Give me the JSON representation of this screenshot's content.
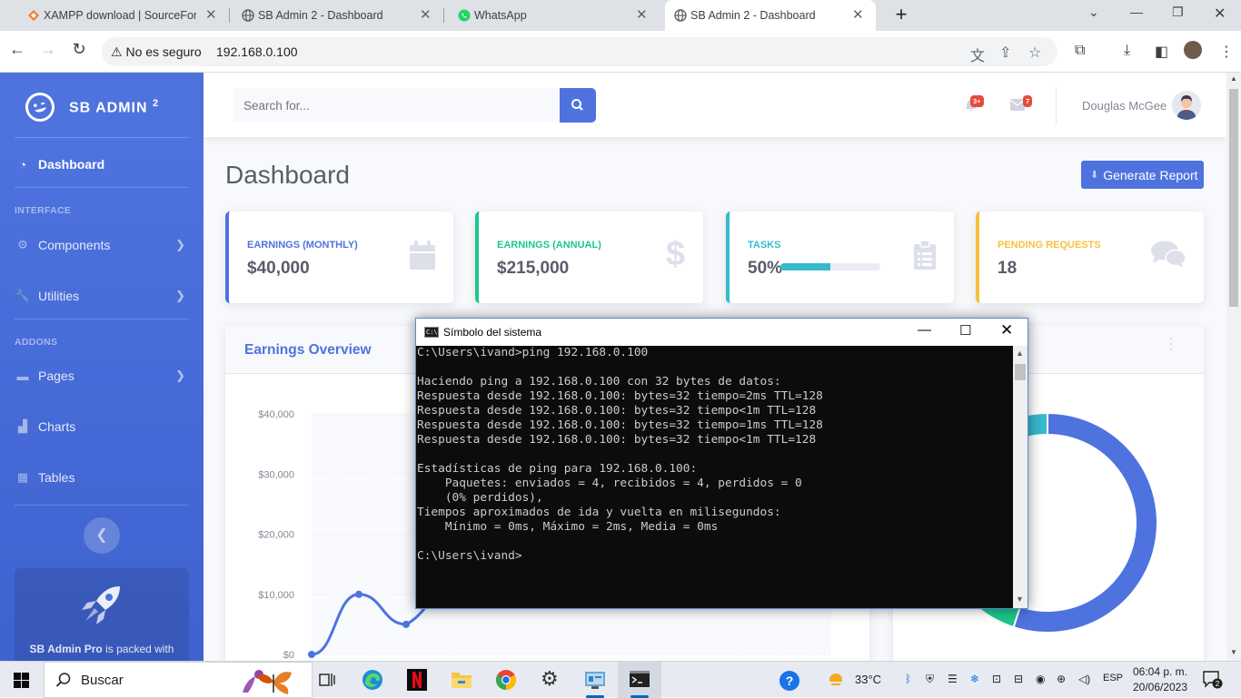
{
  "browser": {
    "tabs": [
      {
        "title": "XAMPP download | SourceForge",
        "icon": "xampp-icon"
      },
      {
        "title": "SB Admin 2 - Dashboard",
        "icon": "globe-icon"
      },
      {
        "title": "WhatsApp",
        "icon": "whatsapp-icon"
      },
      {
        "title": "SB Admin 2 - Dashboard",
        "icon": "globe-icon",
        "active": true
      }
    ],
    "new_tab": "+",
    "security_label": "No es seguro",
    "url": "192.168.0.100"
  },
  "sidebar": {
    "brand": "SB ADMIN",
    "brand_sup": "2",
    "dashboard": "Dashboard",
    "interface_heading": "INTERFACE",
    "components": "Components",
    "utilities": "Utilities",
    "addons_heading": "ADDONS",
    "pages": "Pages",
    "charts": "Charts",
    "tables": "Tables",
    "promo_strong": "SB Admin Pro",
    "promo_text": " is packed with premium features"
  },
  "topbar": {
    "search_placeholder": "Search for...",
    "alerts_badge": "3+",
    "messages_badge": "7",
    "username": "Douglas McGee"
  },
  "main": {
    "title": "Dashboard",
    "report_button": "Generate Report",
    "cards": [
      {
        "label": "EARNINGS (MONTHLY)",
        "value": "$40,000",
        "color": "#4e73df",
        "icon": "calendar-icon"
      },
      {
        "label": "EARNINGS (ANNUAL)",
        "value": "$215,000",
        "color": "#1cc88a",
        "icon": "dollar-icon"
      },
      {
        "label": "TASKS",
        "value": "50%",
        "color": "#36b9cc",
        "icon": "clipboard-icon",
        "progress": 0.5
      },
      {
        "label": "PENDING REQUESTS",
        "value": "18",
        "color": "#f6c23e",
        "icon": "comments-icon"
      }
    ],
    "earnings_title": "Earnings Overview"
  },
  "chart_data": [
    {
      "type": "line",
      "title": "Earnings Overview",
      "y_ticks": [
        "$0",
        "$10,000",
        "$20,000",
        "$30,000",
        "$40,000"
      ],
      "ylim": [
        0,
        40000
      ],
      "series": [
        {
          "values": [
            0,
            10000,
            5000
          ]
        }
      ],
      "grid": true,
      "color": "#4e73df"
    },
    {
      "type": "pie",
      "variant": "doughnut",
      "series": [
        {
          "values": [
            55,
            30,
            15
          ]
        }
      ],
      "colors": [
        "#4e73df",
        "#1cc88a",
        "#36b9cc"
      ]
    }
  ],
  "cmd": {
    "title": "Símbolo del sistema",
    "lines": [
      "C:\\Users\\ivand>ping 192.168.0.100",
      "",
      "Haciendo ping a 192.168.0.100 con 32 bytes de datos:",
      "Respuesta desde 192.168.0.100: bytes=32 tiempo=2ms TTL=128",
      "Respuesta desde 192.168.0.100: bytes=32 tiempo<1m TTL=128",
      "Respuesta desde 192.168.0.100: bytes=32 tiempo=1ms TTL=128",
      "Respuesta desde 192.168.0.100: bytes=32 tiempo<1m TTL=128",
      "",
      "Estadísticas de ping para 192.168.0.100:",
      "    Paquetes: enviados = 4, recibidos = 4, perdidos = 0",
      "    (0% perdidos),",
      "Tiempos aproximados de ida y vuelta en milisegundos:",
      "    Mínimo = 0ms, Máximo = 2ms, Media = 0ms",
      "",
      "C:\\Users\\ivand>"
    ]
  },
  "taskbar": {
    "search_label": "Buscar",
    "temperature": "33°C",
    "language": "ESP",
    "time": "06:04 p. m.",
    "date": "20/06/2023",
    "notifications": "2"
  }
}
